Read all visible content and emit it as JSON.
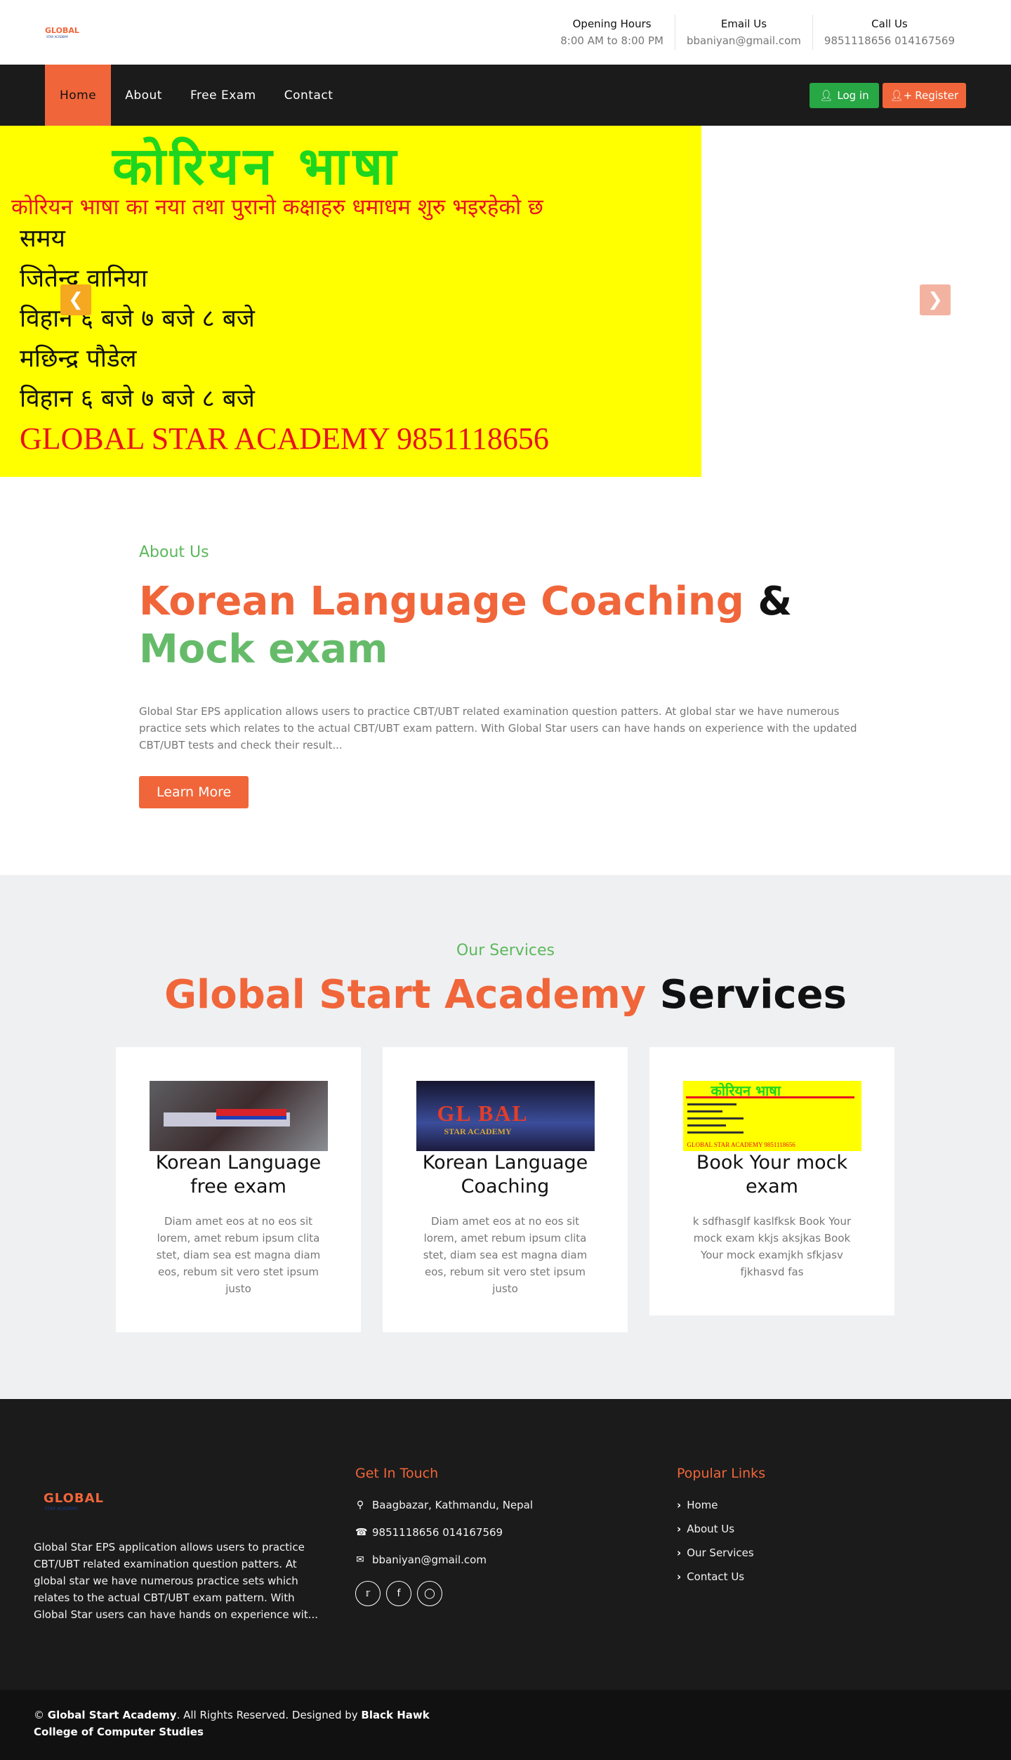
{
  "brand": {
    "logo_text": "GLOBAL",
    "logo_sub": "STAR ACADEMY"
  },
  "topbar": {
    "opening": {
      "title": "Opening Hours",
      "value": "8:00 AM to 8:00 PM"
    },
    "email": {
      "title": "Email Us",
      "value": "bbaniyan@gmail.com"
    },
    "call": {
      "title": "Call Us",
      "value": "9851118656 014167569"
    }
  },
  "nav": {
    "items": [
      "Home",
      "About",
      "Free Exam",
      "Contact"
    ],
    "active": "Home",
    "login_label": "Log in",
    "register_label": "Register"
  },
  "hero": {
    "line1": "कोरियन भाषा",
    "line2": "कोरियन भाषा का नया तथा पुरानो कक्षाहरु धमाधम शुरु भइरहेको छ",
    "line3": "समय",
    "line4": "जितेन्द्र वानिया",
    "line5": "विहान ६ बजे ७ बजे ८ बजे",
    "line6": "मछिन्द्र पौडेल",
    "line7": "विहान ६ बजे ७ बजे ८ बजे",
    "line8": "GLOBAL STAR ACADEMY  9851118656",
    "prev_icon": "chevron-left-icon",
    "next_icon": "chevron-right-icon"
  },
  "about": {
    "eyebrow": "About Us",
    "title_part1": "Korean Language Coaching",
    "title_part2": "&",
    "title_part3": "Mock exam",
    "description": "Global Star EPS application allows users to practice CBT/UBT related examination question patters. At global star we have numerous practice sets which relates to the actual CBT/UBT exam pattern. With Global Star users can have hands on experience with the updated CBT/UBT tests and check their result...",
    "button": "Learn More"
  },
  "services": {
    "eyebrow": "Our Services",
    "title_part1": "Global Start Academy",
    "title_part2": "Services",
    "cards": [
      {
        "title": "Korean Language free exam",
        "text": "Diam amet eos at no eos sit lorem, amet rebum ipsum clita stet, diam sea est magna diam eos, rebum sit vero stet ipsum justo"
      },
      {
        "title": "Korean Language Coaching",
        "text": "Diam amet eos at no eos sit lorem, amet rebum ipsum clita stet, diam sea est magna diam eos, rebum sit vero stet ipsum justo"
      },
      {
        "title": "Book Your mock exam",
        "text": "k sdfhasglf kaslfksk Book Your mock exam kkjs aksjkas Book Your mock examjkh sfkjasv fjkhasvd fas"
      }
    ],
    "card2_img_text": "GL  BAL",
    "card2_img_sub": "STAR ACADEMY",
    "card3_img_title": "कोरियन भाषा",
    "card3_img_footer": "GLOBAL STAR ACADEMY  9851118656"
  },
  "footer": {
    "about_text": "Global Star EPS application allows users to practice CBT/UBT related examination question patters. At global star we have numerous practice sets which relates to the actual CBT/UBT exam pattern. With Global Star users can have hands on experience wit...",
    "contact_heading": "Get In Touch",
    "address": "Baagbazar, Kathmandu, Nepal",
    "phone": "9851118656 014167569",
    "email": "bbaniyan@gmail.com",
    "links_heading": "Popular Links",
    "links": [
      "Home",
      "About Us",
      "Our Services",
      "Contact Us"
    ],
    "copyright_symbol": "©",
    "copyright_name": "Global Start Academy",
    "copyright_mid": ". All Rights Reserved. Designed by",
    "copyright_designer": "Black Hawk College of Computer Studies"
  },
  "colors": {
    "accent": "#f0663a",
    "green": "#66bb6a",
    "dark": "#1b1b1b",
    "banner_yellow": "#ffff00"
  }
}
